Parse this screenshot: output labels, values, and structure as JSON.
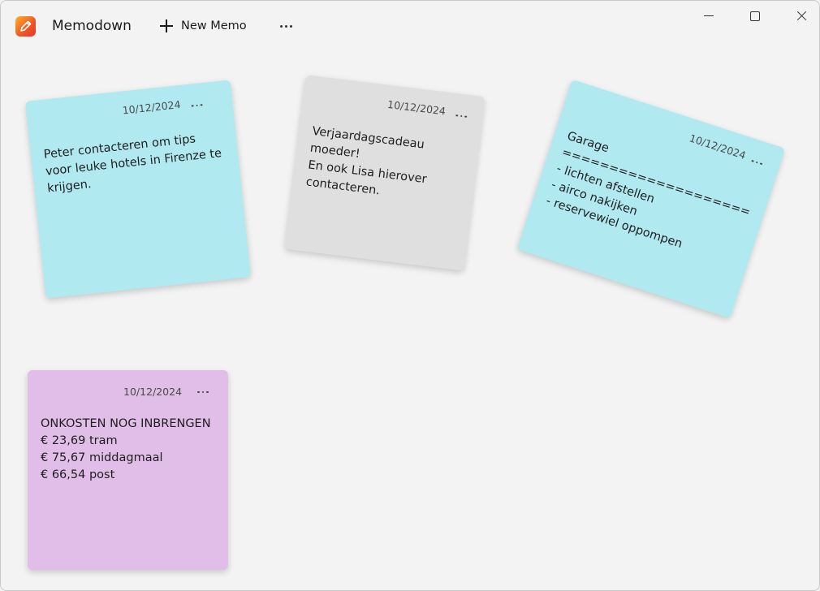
{
  "app": {
    "title": "Memodown",
    "icon": "pencil-icon"
  },
  "toolbar": {
    "new_memo_label": "New Memo",
    "more_label": "···"
  },
  "memos": [
    {
      "date": "10/12/2024",
      "text": "Peter contacteren om tips voor leuke hotels in Firenze te krijgen.",
      "color": "#b1e9f1"
    },
    {
      "date": "10/12/2024",
      "text": "Verjaardagscadeau moeder!\nEn ook Lisa hierover contacteren.",
      "color": "#dfdfdf"
    },
    {
      "date": "10/12/2024",
      "text": "Garage\n====================\n- lichten afstellen\n- airco nakijken\n- reservewiel oppompen",
      "color": "#b1e9f1"
    },
    {
      "date": "10/12/2024",
      "text": "ONKOSTEN NOG INBRENGEN\n€ 23,69 tram\n€ 75,67 middagmaal\n€ 66,54 post",
      "color": "#e1bee7"
    }
  ]
}
